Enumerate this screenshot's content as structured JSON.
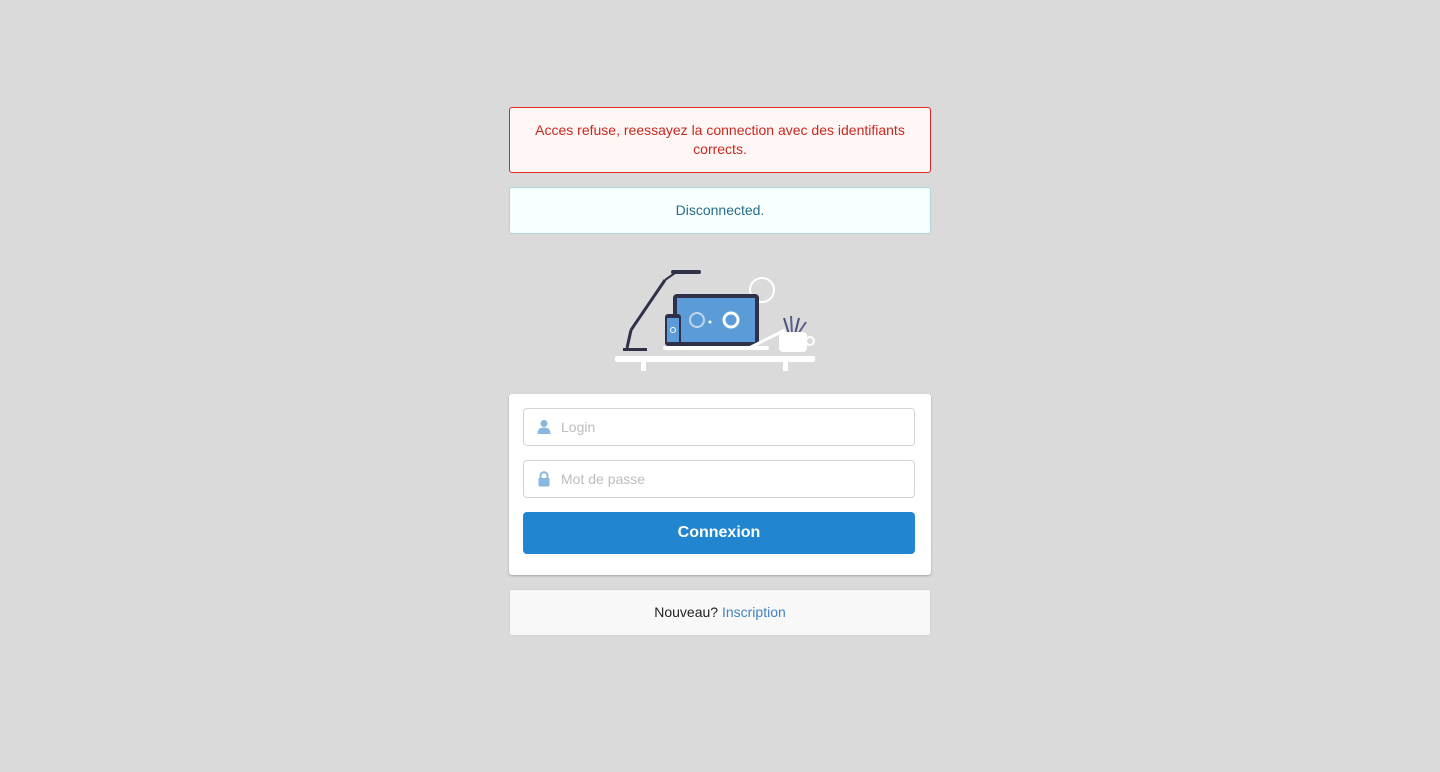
{
  "alerts": {
    "error": "Acces refuse, reessayez la connection avec des identifiants corrects.",
    "info": "Disconnected."
  },
  "illustration": {
    "icon": "desk-workspace-illustration"
  },
  "form": {
    "login_placeholder": "Login",
    "login_icon": "user-icon",
    "password_placeholder": "Mot de passe",
    "password_icon": "lock-icon",
    "submit_label": "Connexion"
  },
  "footer": {
    "prompt": "Nouveau?",
    "link_label": "Inscription"
  },
  "colors": {
    "background": "#dadada",
    "error_text": "#c9281f",
    "error_border": "#db2828",
    "info_text": "#276f86",
    "primary_button": "#2185d0",
    "link": "#4183c4",
    "icon": "#88b8e0"
  }
}
